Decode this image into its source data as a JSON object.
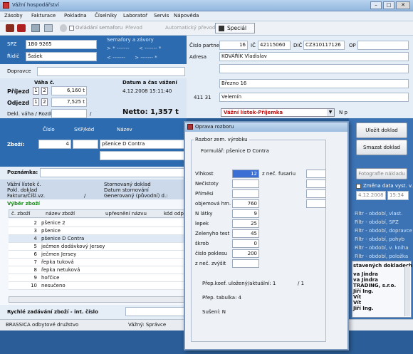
{
  "window": {
    "title": "Vážní hospodářství"
  },
  "menu": [
    "Zásoby",
    "Fakturace",
    "Pokladna",
    "Číselníky",
    "Laboratoř",
    "Servis",
    "Nápověda"
  ],
  "toolbar": {
    "traffic": "Ovládání semaforu",
    "print": "Převod",
    "auto": "Automatický převod",
    "special": "Speciál"
  },
  "vehicle": {
    "spz_label": "SPZ",
    "spz": "1B0 9265",
    "ridic_label": "Řidič",
    "ridic": "Šašek",
    "dopravce_label": "Dopravce"
  },
  "semafor": {
    "title": "Semafory a závory"
  },
  "partner": {
    "cislo_label": "Číslo partnera",
    "cislo": "16",
    "ic_label": "IČ",
    "ic": "42115060",
    "dic_label": "DIČ",
    "dic": "CZ310117126",
    "op_label": "OP",
    "adresa_label": "Adresa",
    "name": "KOVÁŘÍK Vladislav",
    "street": "Březno 16",
    "psc": "411 31",
    "city": "Velemín"
  },
  "weights": {
    "header": "Váha č.",
    "prijezd_label": "Příjezd",
    "prijezd": "6,160 t",
    "odjezd_label": "Odjezd",
    "odjezd": "7,525 t",
    "dt_header": "Datum a čas vážení",
    "datetime": "4.12.2008 15:11:40",
    "dekl_label": "Dekl. váha / Rozdíl",
    "netto": "Netto: 1,357 t"
  },
  "docs": {
    "type": "Vážní lístek-Příjemka",
    "np": "N p"
  },
  "goods": {
    "cislo_h": "Číslo",
    "skp_h": "SKP/kód",
    "nazev_h": "Název",
    "zbozi_label": "Zboží:",
    "cislo": "4",
    "nazev": "pšenice D Contra",
    "poznamka_label": "Poznámka:"
  },
  "info": {
    "l1": "Vážní lístek č.",
    "l2": "Pokl. doklad",
    "l3": "Faktura/Číšl.vz.",
    "m1": "Stornovaný doklad",
    "m2": "Datum stornování",
    "m3": "Generovaný (původní) d.:",
    "slash": "/"
  },
  "select": {
    "title": "Výběr zboží",
    "headers": [
      "č. zboží",
      "název zboží",
      "upřesnění názvu",
      "kód odpadu"
    ],
    "rows": [
      {
        "n": "2",
        "name": "pšenice 2"
      },
      {
        "n": "3",
        "name": "pšenice"
      },
      {
        "n": "4",
        "name": "pšenice D Contra"
      },
      {
        "n": "5",
        "name": "ječmen dodávkový Jersey"
      },
      {
        "n": "6",
        "name": "ječmen Jersey"
      },
      {
        "n": "7",
        "name": "řepka tuková"
      },
      {
        "n": "8",
        "name": "řepka netuková"
      },
      {
        "n": "9",
        "name": "hořčice"
      },
      {
        "n": "10",
        "name": "nesučeno"
      }
    ],
    "quick": "Rychlé zadávání zboží - int. číslo"
  },
  "status": {
    "company": "BRASSICA odbytové družstvo",
    "user": "Vážný: Správce"
  },
  "right": {
    "save": "Uložit doklad",
    "delete": "Smazat doklad",
    "photos": "Fotografie nákladu",
    "change_date": "Změna data vyst. v.l.",
    "date": "4.12.2008",
    "time": "15:34",
    "filters": [
      "Filtr - období, vlast.",
      "Filtr - období, SPZ",
      "Filtr - období, dopravce",
      "Filtr - období, pohyb",
      "Filtr - období, v. kniha",
      "Filtr - období, položka"
    ],
    "list_title": "stavených dokladech",
    "list": [
      "va Jindra",
      "va Jindra",
      "TRADING, s.r.o.",
      "Jiří Ing.",
      "Vít",
      "Vít",
      "Jiří Ing."
    ]
  },
  "dialog": {
    "title": "Oprava rozboru",
    "group": "Rozbor zem. výrobku",
    "formular": "Formulář: pšenice D Contra",
    "fields": [
      {
        "label": "Vlhkost",
        "value": "12"
      },
      {
        "label": "Nečistoty",
        "value": ""
      },
      {
        "label": "Příměsi",
        "value": ""
      },
      {
        "label": "objemová hm.",
        "value": "760"
      },
      {
        "label": "N látky",
        "value": "9"
      },
      {
        "label": "lepek",
        "value": "25"
      },
      {
        "label": "Zelenyho test",
        "value": "45"
      },
      {
        "label": "škrob",
        "value": "0"
      },
      {
        "label": "číslo poklesu",
        "value": "200"
      },
      {
        "label": "z neč. zvýšit",
        "value": ""
      }
    ],
    "fusarium_label": "z neč. fusariu",
    "koef": "Přep.koef. uložený/aktuální: 1",
    "koef_right": "/ 1",
    "tabulka": "Přep. tabulka: 4",
    "suseni": "Sušení: N"
  }
}
